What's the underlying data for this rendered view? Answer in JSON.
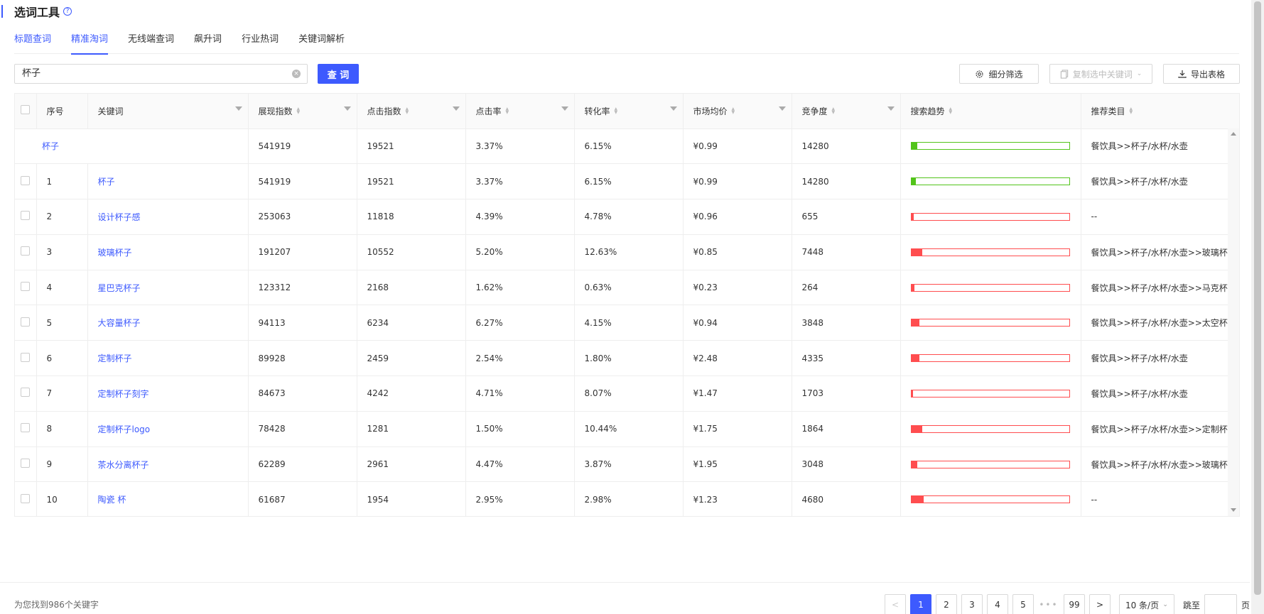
{
  "page": {
    "title": "选词工具",
    "help_icon": "?"
  },
  "tabs": [
    {
      "label": "标题查词",
      "state": "link"
    },
    {
      "label": "精准淘词",
      "state": "active"
    },
    {
      "label": "无线端查词",
      "state": "normal"
    },
    {
      "label": "飙升词",
      "state": "normal"
    },
    {
      "label": "行业热词",
      "state": "normal"
    },
    {
      "label": "关键词解析",
      "state": "normal"
    }
  ],
  "search": {
    "value": "杯子",
    "clear_icon": "×",
    "query_label": "查 词"
  },
  "toolbar": {
    "filter_label": "细分筛选",
    "filter_icon": "gear-icon",
    "copy_label": "复制选中关键词",
    "copy_icon": "copy-icon",
    "export_label": "导出表格",
    "export_icon": "download-icon"
  },
  "table": {
    "columns": [
      "序号",
      "关键词",
      "展现指数",
      "点击指数",
      "点击率",
      "转化率",
      "市场均价",
      "竞争度",
      "搜索趋势",
      "推荐类目"
    ],
    "summary": {
      "keyword": "杯子",
      "impressions": "541919",
      "clicks": "19521",
      "ctr": "3.37%",
      "cvr": "6.15%",
      "price": "¥0.99",
      "competition": "14280",
      "trend": 0.04,
      "trend_color": "#52c41a",
      "category": "餐饮具>>杯子/水杯/水壶"
    },
    "rows": [
      {
        "idx": "1",
        "keyword": "杯子",
        "impressions": "541919",
        "clicks": "19521",
        "ctr": "3.37%",
        "cvr": "6.15%",
        "price": "¥0.99",
        "competition": "14280",
        "trend": 0.03,
        "trend_color": "#52c41a",
        "category": "餐饮具>>杯子/水杯/水壶"
      },
      {
        "idx": "2",
        "keyword": "设计杯子感",
        "impressions": "253063",
        "clicks": "11818",
        "ctr": "4.39%",
        "cvr": "4.78%",
        "price": "¥0.96",
        "competition": "655",
        "trend": 0.015,
        "trend_color": "#ff4d4f",
        "category": "--"
      },
      {
        "idx": "3",
        "keyword": "玻璃杯子",
        "impressions": "191207",
        "clicks": "10552",
        "ctr": "5.20%",
        "cvr": "12.63%",
        "price": "¥0.85",
        "competition": "7448",
        "trend": 0.07,
        "trend_color": "#ff4d4f",
        "category": "餐饮具>>杯子/水杯/水壶>>玻璃杯"
      },
      {
        "idx": "4",
        "keyword": "星巴克杯子",
        "impressions": "123312",
        "clicks": "2168",
        "ctr": "1.62%",
        "cvr": "0.63%",
        "price": "¥0.23",
        "competition": "264",
        "trend": 0.02,
        "trend_color": "#ff4d4f",
        "category": "餐饮具>>杯子/水杯/水壶>>马克杯"
      },
      {
        "idx": "5",
        "keyword": "大容量杯子",
        "impressions": "94113",
        "clicks": "6234",
        "ctr": "6.27%",
        "cvr": "4.15%",
        "price": "¥0.94",
        "competition": "3848",
        "trend": 0.05,
        "trend_color": "#ff4d4f",
        "category": "餐饮具>>杯子/水杯/水壶>>太空杯"
      },
      {
        "idx": "6",
        "keyword": "定制杯子",
        "impressions": "89928",
        "clicks": "2459",
        "ctr": "2.54%",
        "cvr": "1.80%",
        "price": "¥2.48",
        "competition": "4335",
        "trend": 0.05,
        "trend_color": "#ff4d4f",
        "category": "餐饮具>>杯子/水杯/水壶"
      },
      {
        "idx": "7",
        "keyword": "定制杯子刻字",
        "impressions": "84673",
        "clicks": "4242",
        "ctr": "4.71%",
        "cvr": "8.07%",
        "price": "¥1.47",
        "competition": "1703",
        "trend": 0.012,
        "trend_color": "#ff4d4f",
        "category": "餐饮具>>杯子/水杯/水壶"
      },
      {
        "idx": "8",
        "keyword": "定制杯子logo",
        "impressions": "78428",
        "clicks": "1281",
        "ctr": "1.50%",
        "cvr": "10.44%",
        "price": "¥1.75",
        "competition": "1864",
        "trend": 0.07,
        "trend_color": "#ff4d4f",
        "category": "餐饮具>>杯子/水杯/水壶>>定制杯"
      },
      {
        "idx": "9",
        "keyword": "茶水分离杯子",
        "impressions": "62289",
        "clicks": "2961",
        "ctr": "4.47%",
        "cvr": "3.87%",
        "price": "¥1.95",
        "competition": "3048",
        "trend": 0.04,
        "trend_color": "#ff4d4f",
        "category": "餐饮具>>杯子/水杯/水壶>>玻璃杯"
      },
      {
        "idx": "10",
        "keyword": "陶瓷 杯",
        "impressions": "61687",
        "clicks": "1954",
        "ctr": "2.95%",
        "cvr": "2.98%",
        "price": "¥1.23",
        "competition": "4680",
        "trend": 0.08,
        "trend_color": "#ff4d4f",
        "category": "--"
      }
    ]
  },
  "footer": {
    "result_text": "为您找到986个关键字",
    "pages": [
      "1",
      "2",
      "3",
      "4",
      "5"
    ],
    "ellipsis": "•••",
    "last_page": "99",
    "page_size": "10 条/页",
    "jump_label": "跳至",
    "page_unit": "页",
    "prev": "<",
    "next": ">"
  }
}
